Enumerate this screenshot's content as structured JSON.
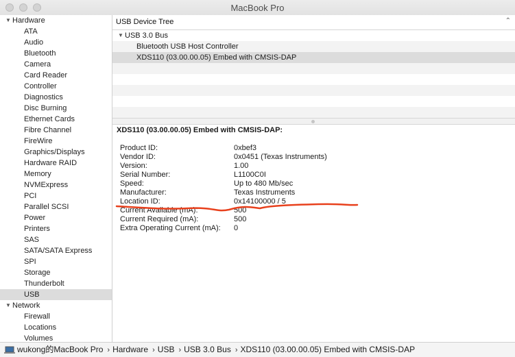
{
  "window": {
    "title": "MacBook Pro"
  },
  "sidebar": {
    "categories": [
      {
        "label": "Hardware",
        "items": [
          "ATA",
          "Audio",
          "Bluetooth",
          "Camera",
          "Card Reader",
          "Controller",
          "Diagnostics",
          "Disc Burning",
          "Ethernet Cards",
          "Fibre Channel",
          "FireWire",
          "Graphics/Displays",
          "Hardware RAID",
          "Memory",
          "NVMExpress",
          "PCI",
          "Parallel SCSI",
          "Power",
          "Printers",
          "SAS",
          "SATA/SATA Express",
          "SPI",
          "Storage",
          "Thunderbolt",
          "USB"
        ]
      },
      {
        "label": "Network",
        "items": [
          "Firewall",
          "Locations",
          "Volumes"
        ]
      }
    ],
    "selected": "USB"
  },
  "tree": {
    "header": "USB Device Tree",
    "bus": "USB 3.0 Bus",
    "devices": [
      "Bluetooth USB Host Controller",
      "XDS110 (03.00.00.05) Embed with CMSIS-DAP"
    ],
    "selected_index": 1
  },
  "details": {
    "title": "XDS110 (03.00.00.05) Embed with CMSIS-DAP:",
    "rows": [
      {
        "label": "Product ID:",
        "value": "0xbef3"
      },
      {
        "label": "Vendor ID:",
        "value": "0x0451  (Texas Instruments)"
      },
      {
        "label": "Version:",
        "value": "1.00"
      },
      {
        "label": "Serial Number:",
        "value": "L1100C0I"
      },
      {
        "label": "Speed:",
        "value": "Up to 480 Mb/sec"
      },
      {
        "label": "Manufacturer:",
        "value": "Texas Instruments"
      },
      {
        "label": "Location ID:",
        "value": "0x14100000 / 5"
      },
      {
        "label": "Current Available (mA):",
        "value": "500"
      },
      {
        "label": "Current Required (mA):",
        "value": "500"
      },
      {
        "label": "Extra Operating Current (mA):",
        "value": "0"
      }
    ],
    "annotation_color": "#e8401c"
  },
  "pathbar": {
    "crumbs": [
      "wukong的MacBook Pro",
      "Hardware",
      "USB",
      "USB 3.0 Bus",
      "XDS110 (03.00.00.05) Embed with CMSIS-DAP"
    ]
  }
}
